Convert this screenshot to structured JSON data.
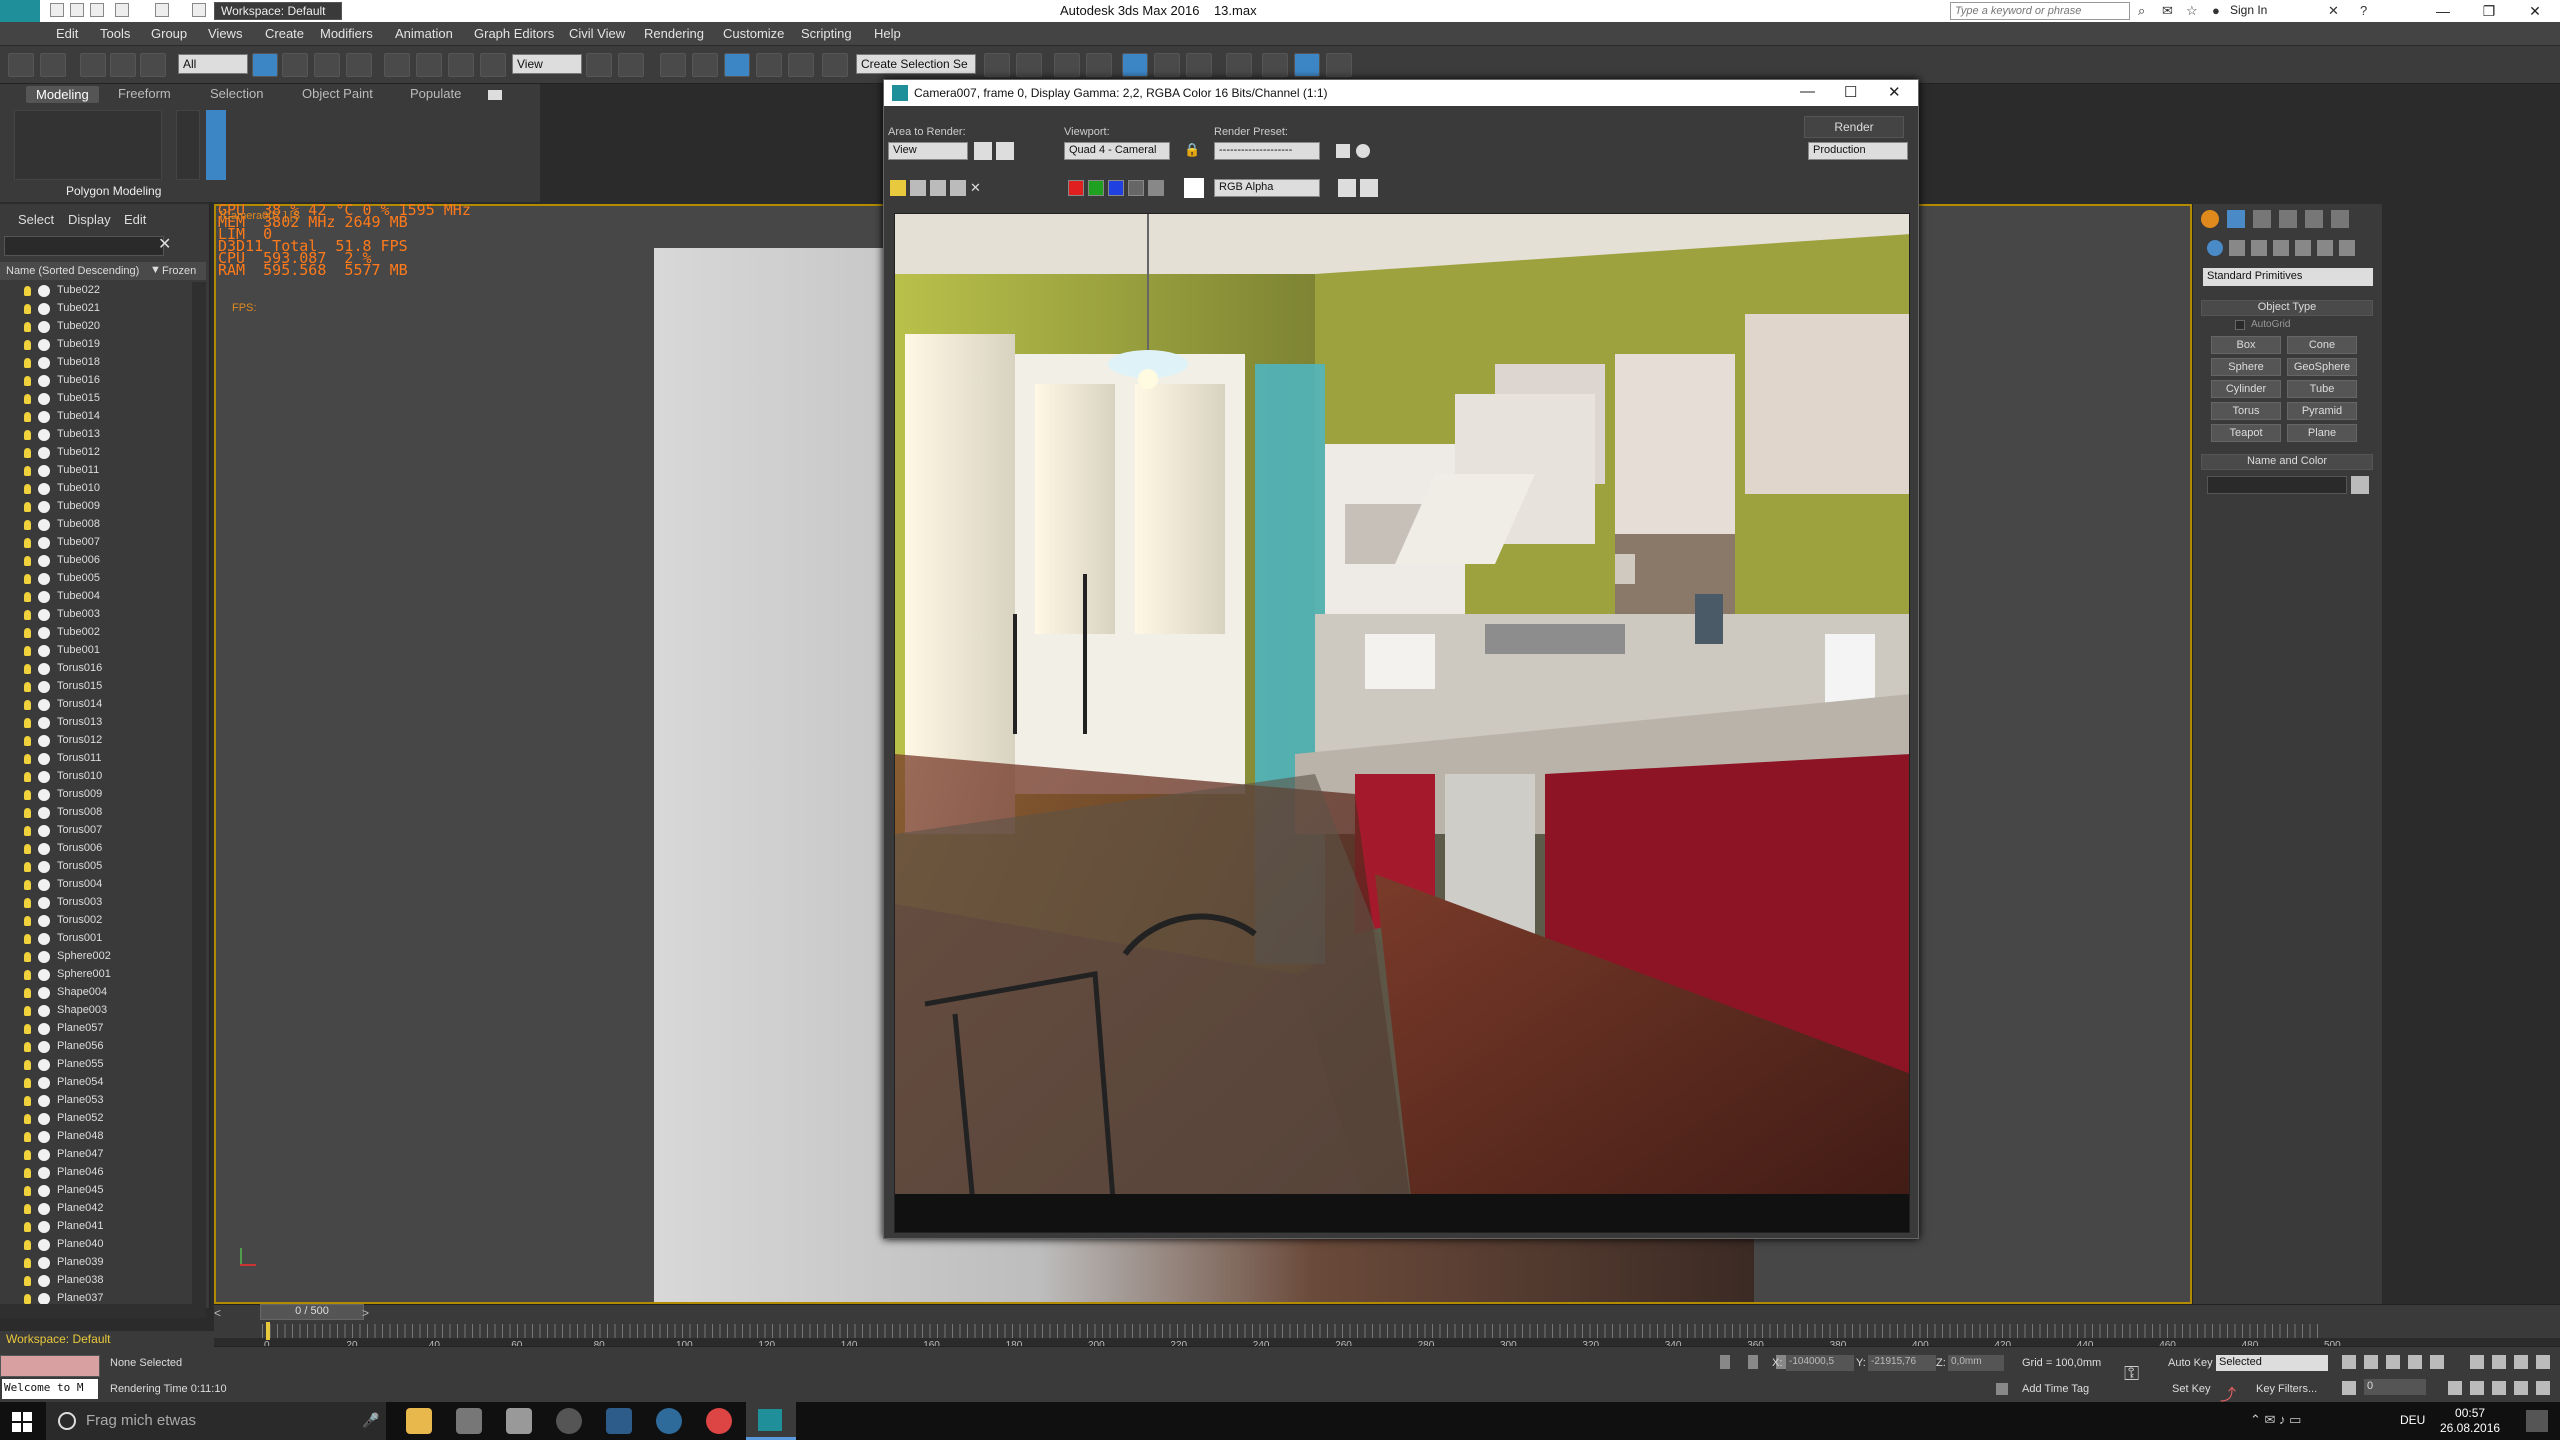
{
  "app": {
    "title": "Autodesk 3ds Max 2016",
    "file": "13.max",
    "workspace": "Workspace: Default",
    "search_placeholder": "Type a keyword or phrase",
    "sign_in": "Sign In"
  },
  "menu": [
    "Edit",
    "Tools",
    "Group",
    "Views",
    "Create",
    "Modifiers",
    "Animation",
    "Graph Editors",
    "Civil View",
    "Rendering",
    "Customize",
    "Scripting",
    "Help"
  ],
  "toolbar": {
    "filter": "All",
    "ref_coord": "View",
    "named_sel": "Create Selection Se"
  },
  "ribbon": {
    "tabs": [
      "Modeling",
      "Freeform",
      "Selection",
      "Object Paint",
      "Populate"
    ],
    "active": "Modeling",
    "panel": "Polygon Modeling"
  },
  "scene_explorer": {
    "tabs": [
      "Select",
      "Display",
      "Edit"
    ],
    "col_name": "Name (Sorted Descending)",
    "col_frozen": "Frozen",
    "objects": [
      "Tube022",
      "Tube021",
      "Tube020",
      "Tube019",
      "Tube018",
      "Tube016",
      "Tube015",
      "Tube014",
      "Tube013",
      "Tube012",
      "Tube011",
      "Tube010",
      "Tube009",
      "Tube008",
      "Tube007",
      "Tube006",
      "Tube005",
      "Tube004",
      "Tube003",
      "Tube002",
      "Tube001",
      "Torus016",
      "Torus015",
      "Torus014",
      "Torus013",
      "Torus012",
      "Torus011",
      "Torus010",
      "Torus009",
      "Torus008",
      "Torus007",
      "Torus006",
      "Torus005",
      "Torus004",
      "Torus003",
      "Torus002",
      "Torus001",
      "Sphere002",
      "Sphere001",
      "Shape004",
      "Shape003",
      "Plane057",
      "Plane056",
      "Plane055",
      "Plane054",
      "Plane053",
      "Plane052",
      "Plane048",
      "Plane047",
      "Plane046",
      "Plane045",
      "Plane042",
      "Plane041",
      "Plane040",
      "Plane039",
      "Plane038",
      "Plane037"
    ]
  },
  "viewport": {
    "label": "[Camera007 ] [S",
    "fps_label": "FPS:",
    "overlay": "GPU  38 % 42 °C 0 % 1595 MHz\nMEM  3802 MHz 2649 MB\nLIM  0\nD3D11 Total  51.8 FPS\nCPU  593.087  2 %\nRAM  595.568  5577 MB"
  },
  "render_window": {
    "title": "Camera007, frame 0, Display Gamma: 2,2, RGBA Color 16 Bits/Channel (1:1)",
    "area_label": "Area to Render:",
    "area_value": "View",
    "viewport_label": "Viewport:",
    "viewport_value": "Quad 4 - Cameral",
    "preset_label": "Render Preset:",
    "preset_value": "--------------------",
    "render_button": "Render",
    "mode_value": "Production",
    "channel_value": "RGB Alpha"
  },
  "command_panel": {
    "category": "Standard Primitives",
    "object_type": "Object Type",
    "autogrid": "AutoGrid",
    "buttons": [
      "Box",
      "Cone",
      "Sphere",
      "GeoSphere",
      "Cylinder",
      "Tube",
      "Torus",
      "Pyramid",
      "Teapot",
      "Plane"
    ],
    "name_color": "Name and Color"
  },
  "timeline": {
    "frame": "0 / 500",
    "ticks": [
      "0",
      "20",
      "40",
      "60",
      "80",
      "100",
      "120",
      "140",
      "160",
      "180",
      "200",
      "220",
      "240",
      "260",
      "280",
      "300",
      "320",
      "340",
      "360",
      "380",
      "400",
      "420",
      "440",
      "460",
      "480",
      "500"
    ]
  },
  "status": {
    "workspace": "Workspace: Default",
    "selection": "None Selected",
    "render_time": "Rendering Time  0:11:10",
    "welcome": "Welcome to M",
    "x": "-104000,5",
    "y": "-21915,76",
    "z": "0,0mm",
    "grid": "Grid = 100,0mm",
    "add_time_tag": "Add Time Tag",
    "auto_key": "Auto Key",
    "set_key": "Set Key",
    "selected": "Selected",
    "key_filters": "Key Filters...",
    "frame_field": "0"
  },
  "taskbar": {
    "search": "Frag mich etwas",
    "lang": "DEU",
    "time": "00:57",
    "date": "26.08.2016"
  },
  "colors": {
    "accent": "#3d86c6",
    "viewport_border": "#b38b00",
    "overlay": "#ff7a1a"
  }
}
